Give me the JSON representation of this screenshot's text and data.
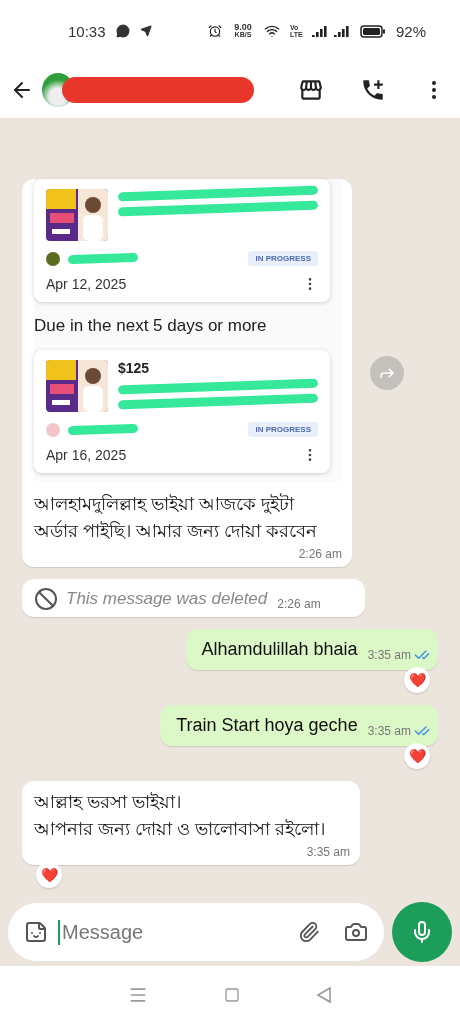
{
  "status_bar": {
    "time": "10:33",
    "speed": "9.00",
    "speed_unit": "KB/S",
    "network": "Vo LTE",
    "battery": "92%"
  },
  "messages": [
    {
      "kind": "orders",
      "outgoing": false,
      "items": [
        {
          "kind": "card",
          "status": "IN PROGRESS",
          "date": "Apr 12, 2025"
        },
        {
          "kind": "heading",
          "text": "Due in the next 5 days or more"
        },
        {
          "kind": "card",
          "price": "$125",
          "status": "IN PROGRESS",
          "date": "Apr 16, 2025"
        }
      ],
      "text": "আলহামদুলিল্লাহ ভাইয়া আজকে দুইটা অর্ডার পাইছি। আমার জন্য দোয়া করবেন",
      "time": "2:26 am"
    },
    {
      "kind": "deleted",
      "outgoing": false,
      "text": "This message was deleted",
      "time": "2:26 am"
    },
    {
      "kind": "text",
      "outgoing": true,
      "text": "Alhamdulillah bhaia",
      "time": "3:35 am",
      "read": true,
      "reaction": "❤️"
    },
    {
      "kind": "text",
      "outgoing": true,
      "text": "Train Start hoya geche",
      "time": "3:35 am",
      "read": true,
      "reaction": "❤️"
    },
    {
      "kind": "text",
      "outgoing": false,
      "text": "আল্লাহ ভরসা ভাইয়া।\n আপনার জন্য দোয়া ও ভালোবাসা রইলো।",
      "time": "3:35 am",
      "reaction": "❤️"
    }
  ],
  "composer": {
    "placeholder": "Message"
  }
}
